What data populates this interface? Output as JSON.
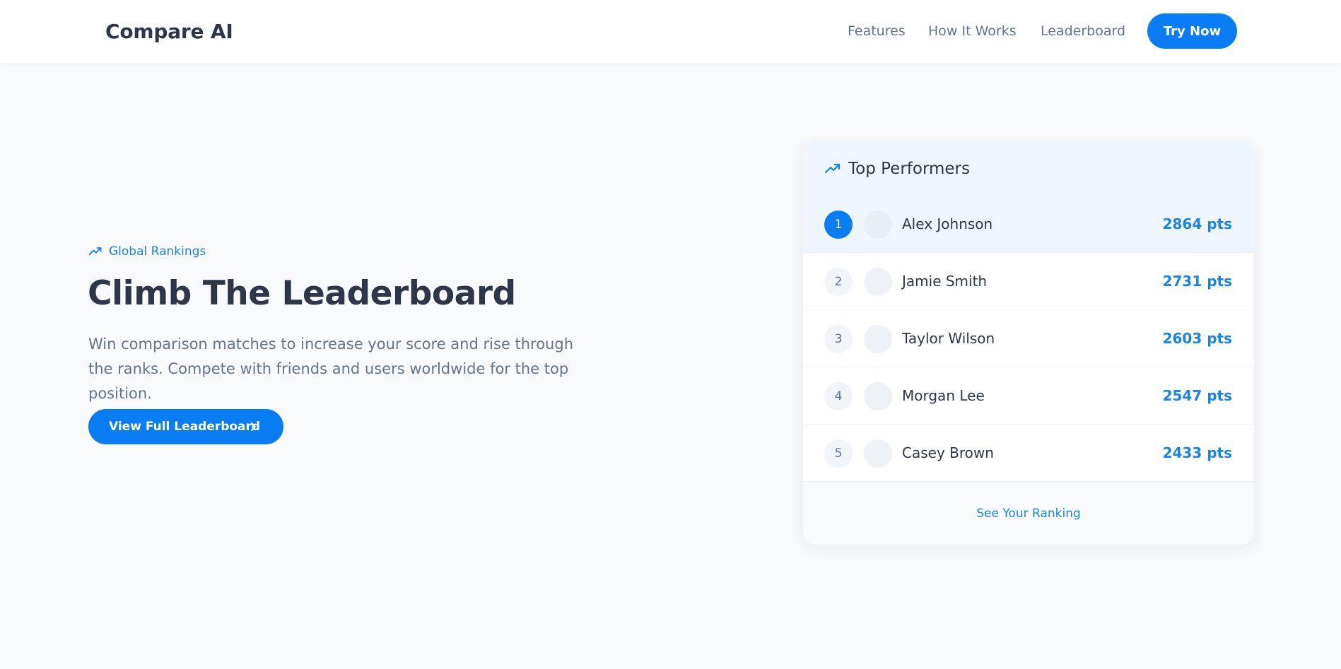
{
  "nav": {
    "brand": "Compare AI",
    "links": [
      "Features",
      "How It Works",
      "Leaderboard"
    ],
    "cta": "Try Now"
  },
  "hero": {
    "eyebrow": "Global Rankings",
    "title": "Climb The Leaderboard",
    "description": "Win comparison matches to increase your score and rise through the ranks. Compete with friends and users worldwide for the top position.",
    "button": "View Full Leaderboard"
  },
  "leaderboard": {
    "title": "Top Performers",
    "rows": [
      {
        "rank": "1",
        "name": "Alex Johnson",
        "score": "2864 pts"
      },
      {
        "rank": "2",
        "name": "Jamie Smith",
        "score": "2731 pts"
      },
      {
        "rank": "3",
        "name": "Taylor Wilson",
        "score": "2603 pts"
      },
      {
        "rank": "4",
        "name": "Morgan Lee",
        "score": "2547 pts"
      },
      {
        "rank": "5",
        "name": "Casey Brown",
        "score": "2433 pts"
      }
    ],
    "footer_link": "See Your Ranking"
  },
  "icons": {
    "trend": "trending-up-icon",
    "chevron": "chevron-right-icon"
  },
  "colors": {
    "accent": "#0a7cf4",
    "accent_text": "#1a84e3",
    "heading": "#2d3748",
    "muted": "#64748b",
    "background": "#f8fafc"
  }
}
